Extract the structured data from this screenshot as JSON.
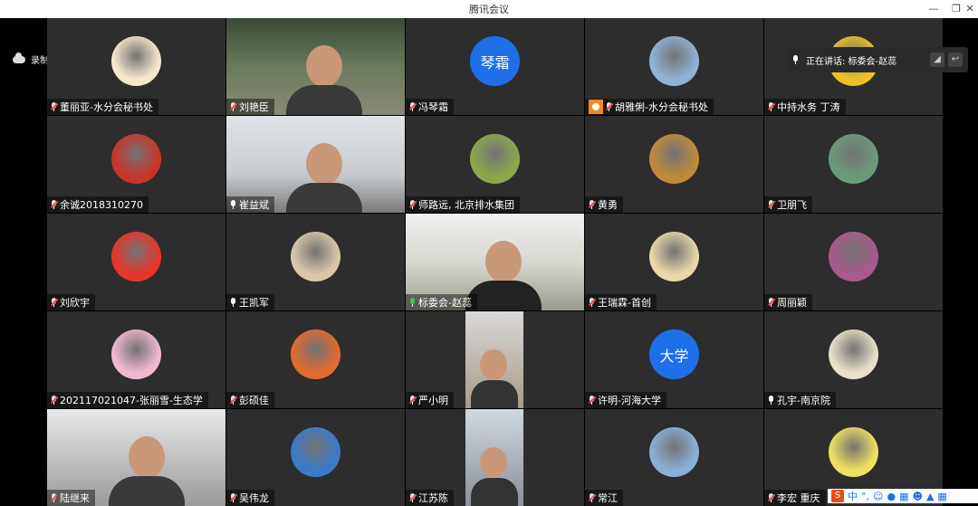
{
  "window": {
    "title": "腾讯会议",
    "minimize": "—",
    "restore": "❐",
    "close": "✕"
  },
  "recording": {
    "label": "录制中"
  },
  "speaking": {
    "label": "正在讲话: 标委会-赵蕊"
  },
  "ime": {
    "lang": "中",
    "punct": "°,"
  },
  "participants": [
    {
      "name": "董丽亚-水分会秘书处",
      "mic": "muted",
      "kind": "avatar",
      "avatar_bg": "#f4e8c9"
    },
    {
      "name": "刘艳臣",
      "mic": "muted",
      "kind": "video",
      "scene": "bookshelf"
    },
    {
      "name": "冯琴霜",
      "mic": "muted",
      "kind": "text",
      "avatar_text": "琴霜"
    },
    {
      "name": "胡雅俐-水分会秘书处",
      "mic": "muted",
      "kind": "avatar",
      "avatar_bg": "#8fb3d6",
      "badge": true
    },
    {
      "name": "中持水务 丁涛",
      "mic": "muted",
      "kind": "avatar",
      "avatar_bg": "#f0c020"
    },
    {
      "name": "余诚2018310270",
      "mic": "muted",
      "kind": "avatar",
      "avatar_bg": "#c8342a"
    },
    {
      "name": "崔益斌",
      "mic": "on",
      "kind": "video",
      "scene": "office"
    },
    {
      "name": "师路远, 北京排水集团",
      "mic": "muted",
      "kind": "avatar",
      "avatar_bg": "#8aa84a"
    },
    {
      "name": "黄勇",
      "mic": "muted",
      "kind": "avatar",
      "avatar_bg": "#c08a3a"
    },
    {
      "name": "卫朋飞",
      "mic": "muted",
      "kind": "avatar",
      "avatar_bg": "#6a9a7a"
    },
    {
      "name": "刘欣宇",
      "mic": "muted",
      "kind": "avatar",
      "avatar_bg": "#e8342a"
    },
    {
      "name": "王凯军",
      "mic": "on",
      "kind": "avatar",
      "avatar_bg": "#d8c8a8"
    },
    {
      "name": "标委会-赵蕊",
      "mic": "speaking",
      "kind": "video",
      "scene": "room",
      "active": true
    },
    {
      "name": "王瑞霖-首创",
      "mic": "muted",
      "kind": "avatar",
      "avatar_bg": "#e8d8a8"
    },
    {
      "name": "周丽颖",
      "mic": "muted",
      "kind": "avatar",
      "avatar_bg": "#a85a8a"
    },
    {
      "name": "202117021047-张丽雪-生态学",
      "mic": "muted",
      "kind": "avatar",
      "avatar_bg": "#f0b8d0"
    },
    {
      "name": "彭硕佳",
      "mic": "muted",
      "kind": "avatar",
      "avatar_bg": "#e06a30"
    },
    {
      "name": "严小明",
      "mic": "muted",
      "kind": "video",
      "scene": "portrait"
    },
    {
      "name": "许明-河海大学",
      "mic": "muted",
      "kind": "text",
      "avatar_text": "大学"
    },
    {
      "name": "孔宇-南京院",
      "mic": "on",
      "kind": "avatar",
      "avatar_bg": "#e8e0c8"
    },
    {
      "name": "陆继来",
      "mic": "muted",
      "kind": "video",
      "scene": "office2"
    },
    {
      "name": "吴伟龙",
      "mic": "muted",
      "kind": "avatar",
      "avatar_bg": "#3a7ac8"
    },
    {
      "name": "江苏陈",
      "mic": "muted",
      "kind": "video",
      "scene": "portrait2"
    },
    {
      "name": "常江",
      "mic": "muted",
      "kind": "avatar",
      "avatar_bg": "#8ab0d8"
    },
    {
      "name": "李宏 重庆",
      "mic": "muted",
      "kind": "avatar",
      "avatar_bg": "#f0e060"
    }
  ]
}
